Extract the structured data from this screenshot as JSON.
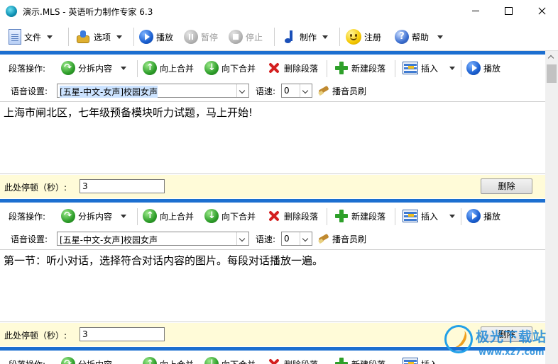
{
  "window": {
    "title": "演示.MLS - 英语听力制作专家 6.3"
  },
  "toolbar": {
    "file": "文件",
    "options": "选项",
    "play": "播放",
    "pause": "暂停",
    "stop": "停止",
    "make": "制作",
    "register": "注册",
    "help": "帮助"
  },
  "para_labels": {
    "ops": "段落操作:",
    "split": "分拆内容",
    "merge_up": "向上合并",
    "merge_down": "向下合并",
    "delete_para": "删除段落",
    "new_para": "新建段落",
    "insert": "插入",
    "play": "播放",
    "voice_setting": "语音设置:",
    "speed": "语速:",
    "announcer_brush": "播音员刷",
    "pause_label": "此处停顿（秒）:",
    "delete_button": "删除"
  },
  "paragraphs": [
    {
      "voice": "[五星-中文-女声]校园女声",
      "speed": "0",
      "text": "上海市闸北区，七年级预备模块听力试题，马上开始!",
      "pause": "3"
    },
    {
      "voice": "[五星-中文-女声]校园女声",
      "speed": "0",
      "text": "第一节：听小对话，选择符合对话内容的图片。每段对话播放一遍。",
      "pause": "3"
    }
  ],
  "watermark": {
    "name": "极光下载站",
    "url": "www.xz7.com"
  },
  "colors": {
    "accent_blue": "#1c6fd0",
    "pause_row_bg": "#fffbd8"
  }
}
